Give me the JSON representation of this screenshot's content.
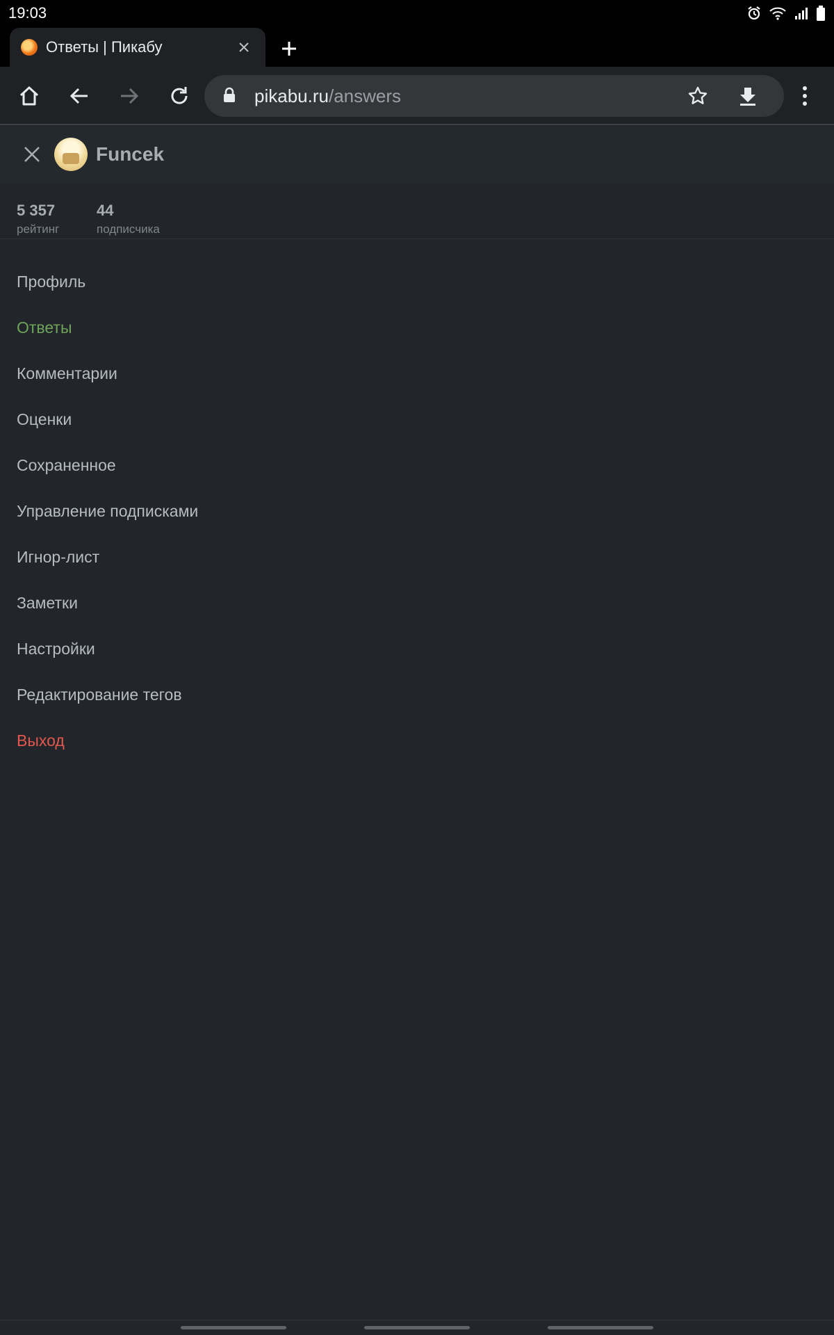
{
  "status_bar": {
    "time": "19:03",
    "icons": [
      "alarm-icon",
      "wifi-icon",
      "signal-icon",
      "battery-icon"
    ]
  },
  "browser": {
    "tab": {
      "title": "Ответы | Пикабу",
      "favicon": "pikabu-favicon-icon"
    },
    "url_host": "pikabu.ru",
    "url_path": "/answers"
  },
  "profile": {
    "username": "Funcek",
    "stats": [
      {
        "value": "5 357",
        "label": "рейтинг"
      },
      {
        "value": "44",
        "label": "подписчика"
      }
    ]
  },
  "menu": {
    "items": [
      {
        "label": "Профиль"
      },
      {
        "label": "Ответы"
      },
      {
        "label": "Комментарии"
      },
      {
        "label": "Оценки"
      },
      {
        "label": "Сохраненное"
      },
      {
        "label": "Управление подписками"
      },
      {
        "label": "Игнор-лист"
      },
      {
        "label": "Заметки"
      },
      {
        "label": "Настройки"
      },
      {
        "label": "Редактирование тегов"
      },
      {
        "label": "Выход"
      }
    ],
    "active_item": "Ответы"
  },
  "colors": {
    "background": "#22262b",
    "active": "#6ea35a",
    "logout": "#e3574d",
    "text": "#b6bcc1"
  }
}
